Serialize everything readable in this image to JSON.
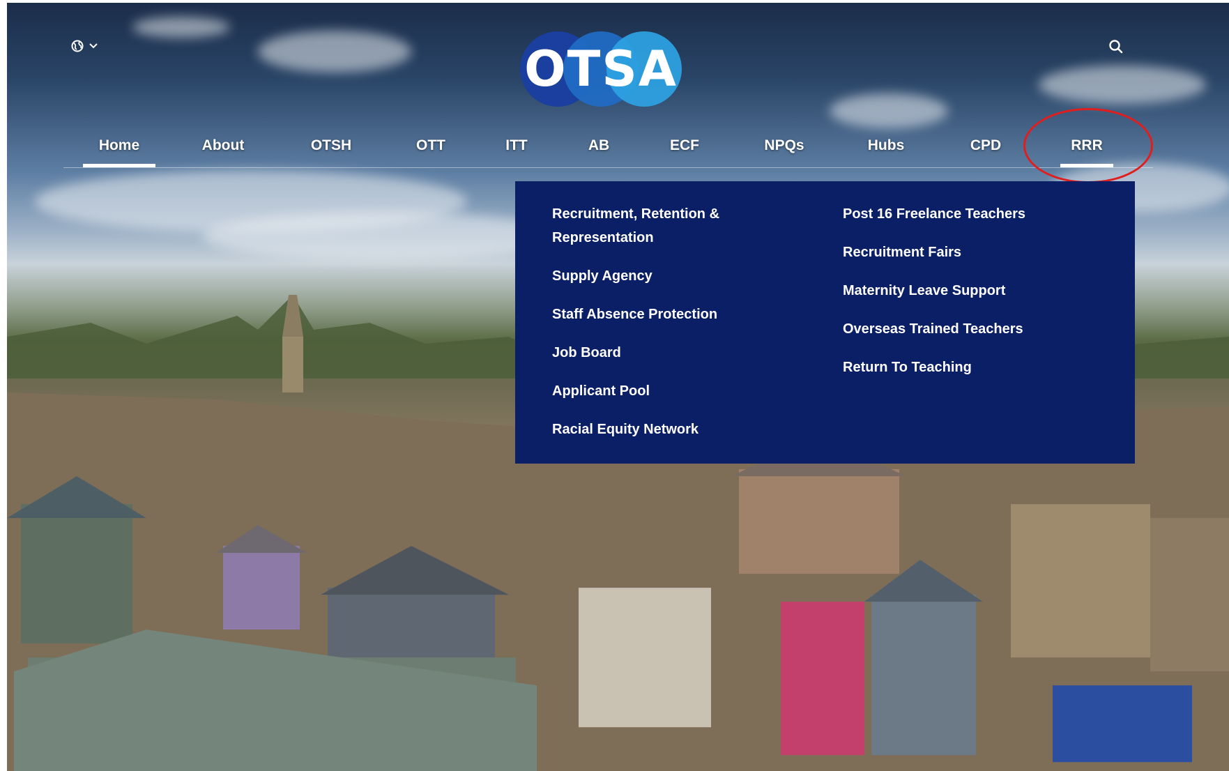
{
  "header": {
    "language_icon": "globe-icon",
    "language_caret_icon": "chevron-down-icon",
    "search_icon": "search-icon",
    "logo_text": "OTSA"
  },
  "nav": {
    "items": [
      {
        "label": "Home",
        "active": true
      },
      {
        "label": "About",
        "active": false
      },
      {
        "label": "OTSH",
        "active": false
      },
      {
        "label": "OTT",
        "active": false
      },
      {
        "label": "ITT",
        "active": false
      },
      {
        "label": "AB",
        "active": false
      },
      {
        "label": "ECF",
        "active": false
      },
      {
        "label": "NPQs",
        "active": false
      },
      {
        "label": "Hubs",
        "active": false
      },
      {
        "label": "CPD",
        "active": false
      },
      {
        "label": "RRR",
        "active": true
      }
    ]
  },
  "dropdown": {
    "left_column": [
      "Recruitment, Retention & Representation",
      "Supply Agency",
      "Staff Absence Protection",
      "Job Board",
      "Applicant Pool",
      "Racial Equity Network"
    ],
    "right_column": [
      "Post 16 Freelance Teachers",
      "Recruitment Fairs",
      "Maternity Leave Support",
      "Overseas Trained Teachers",
      "Return To Teaching"
    ]
  },
  "colors": {
    "dropdown_background": "#0b1f66",
    "annotation_ring": "#e01e1e",
    "logo_blue_dark": "#1a3f9e",
    "logo_blue_mid": "#1f6cc6",
    "logo_blue_light": "#2ea3e3"
  }
}
